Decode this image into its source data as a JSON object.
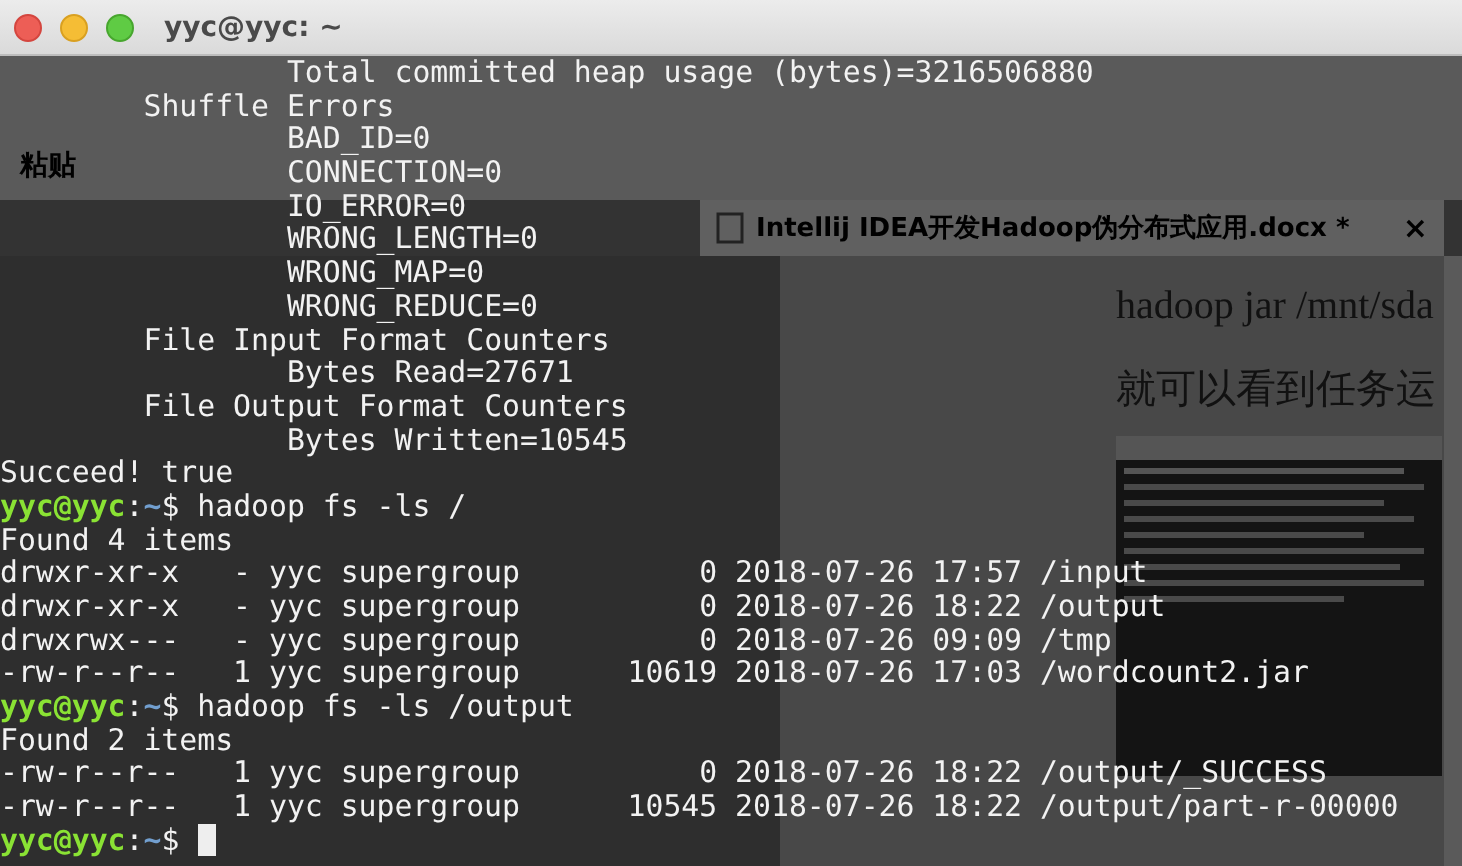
{
  "window": {
    "title": "yyc@yyc: ~"
  },
  "background_app": {
    "ribbon": {
      "paste_label": "粘贴"
    },
    "tab": {
      "title": "Intellij IDEA开发Hadoop伪分布式应用.docx *",
      "close": "×"
    },
    "document": {
      "lines": [
        "hadoop jar /mnt/sda",
        "就可以看到任务运"
      ]
    }
  },
  "terminal": {
    "lines": [
      {
        "kind": "output",
        "text": "                Total committed heap usage (bytes)=3216506880"
      },
      {
        "kind": "output",
        "text": "        Shuffle Errors"
      },
      {
        "kind": "output",
        "text": "                BAD_ID=0"
      },
      {
        "kind": "output",
        "text": "                CONNECTION=0"
      },
      {
        "kind": "output",
        "text": "                IO_ERROR=0"
      },
      {
        "kind": "output",
        "text": "                WRONG_LENGTH=0"
      },
      {
        "kind": "output",
        "text": "                WRONG_MAP=0"
      },
      {
        "kind": "output",
        "text": "                WRONG_REDUCE=0"
      },
      {
        "kind": "output",
        "text": "        File Input Format Counters"
      },
      {
        "kind": "output",
        "text": "                Bytes Read=27671"
      },
      {
        "kind": "output",
        "text": "        File Output Format Counters"
      },
      {
        "kind": "output",
        "text": "                Bytes Written=10545"
      },
      {
        "kind": "output",
        "text": "Succeed! true"
      },
      {
        "kind": "prompt",
        "user": "yyc@yyc",
        "separator": ":",
        "path": "~",
        "symbol": "$",
        "command": "hadoop fs -ls /",
        "cursor": false
      },
      {
        "kind": "output",
        "text": "Found 4 items"
      },
      {
        "kind": "output",
        "text": "drwxr-xr-x   - yyc supergroup          0 2018-07-26 17:57 /input"
      },
      {
        "kind": "output",
        "text": "drwxr-xr-x   - yyc supergroup          0 2018-07-26 18:22 /output"
      },
      {
        "kind": "output",
        "text": "drwxrwx---   - yyc supergroup          0 2018-07-26 09:09 /tmp"
      },
      {
        "kind": "output",
        "text": "-rw-r--r--   1 yyc supergroup      10619 2018-07-26 17:03 /wordcount2.jar"
      },
      {
        "kind": "prompt",
        "user": "yyc@yyc",
        "separator": ":",
        "path": "~",
        "symbol": "$",
        "command": "hadoop fs -ls /output",
        "cursor": false
      },
      {
        "kind": "output",
        "text": "Found 2 items"
      },
      {
        "kind": "output",
        "text": "-rw-r--r--   1 yyc supergroup          0 2018-07-26 18:22 /output/_SUCCESS"
      },
      {
        "kind": "output",
        "text": "-rw-r--r--   1 yyc supergroup      10545 2018-07-26 18:22 /output/part-r-00000"
      },
      {
        "kind": "prompt",
        "user": "yyc@yyc",
        "separator": ":",
        "path": "~",
        "symbol": "$",
        "cursor": true
      }
    ]
  }
}
